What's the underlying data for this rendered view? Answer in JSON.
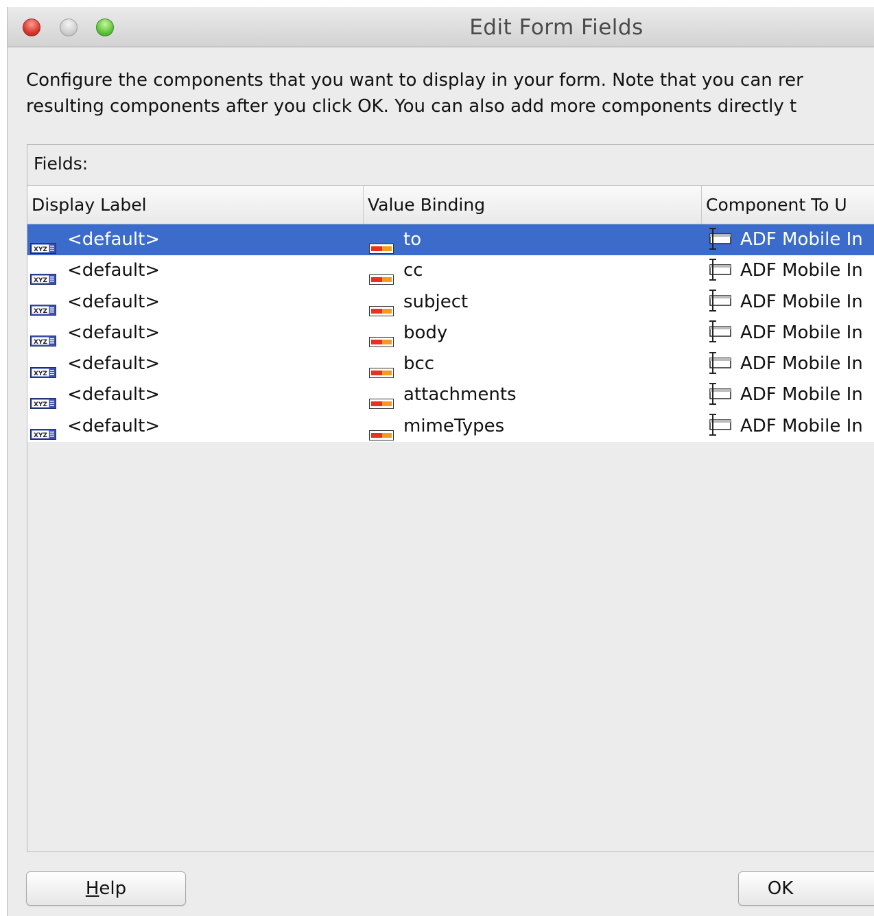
{
  "window": {
    "title": "Edit Form Fields"
  },
  "description": {
    "line1": "Configure the components that you want to display in your form.  Note that you can rer",
    "line2": "resulting components after you click OK.  You can also add more components directly t"
  },
  "fields": {
    "label": "Fields:",
    "columns": [
      "Display Label",
      "Value Binding",
      "Component To U"
    ],
    "rows": [
      {
        "display_label": "<default>",
        "value_binding": "to",
        "component": "ADF Mobile In",
        "selected": true
      },
      {
        "display_label": "<default>",
        "value_binding": "cc",
        "component": "ADF Mobile In",
        "selected": false
      },
      {
        "display_label": "<default>",
        "value_binding": "subject",
        "component": "ADF Mobile In",
        "selected": false
      },
      {
        "display_label": "<default>",
        "value_binding": "body",
        "component": "ADF Mobile In",
        "selected": false
      },
      {
        "display_label": "<default>",
        "value_binding": "bcc",
        "component": "ADF Mobile In",
        "selected": false
      },
      {
        "display_label": "<default>",
        "value_binding": "attachments",
        "component": "ADF Mobile In",
        "selected": false
      },
      {
        "display_label": "<default>",
        "value_binding": "mimeTypes",
        "component": "ADF Mobile In",
        "selected": false
      }
    ]
  },
  "buttons": {
    "help_mnemonic": "H",
    "help_rest": "elp",
    "ok": "OK"
  },
  "icons": {
    "display_label": "xyz-label-icon",
    "value_binding": "attribute-binding-icon",
    "component": "input-text-component-icon"
  },
  "colors": {
    "selection": "#3b6ccc",
    "binding_icon_red": "#e8321e",
    "binding_icon_orange": "#f59b1b"
  }
}
